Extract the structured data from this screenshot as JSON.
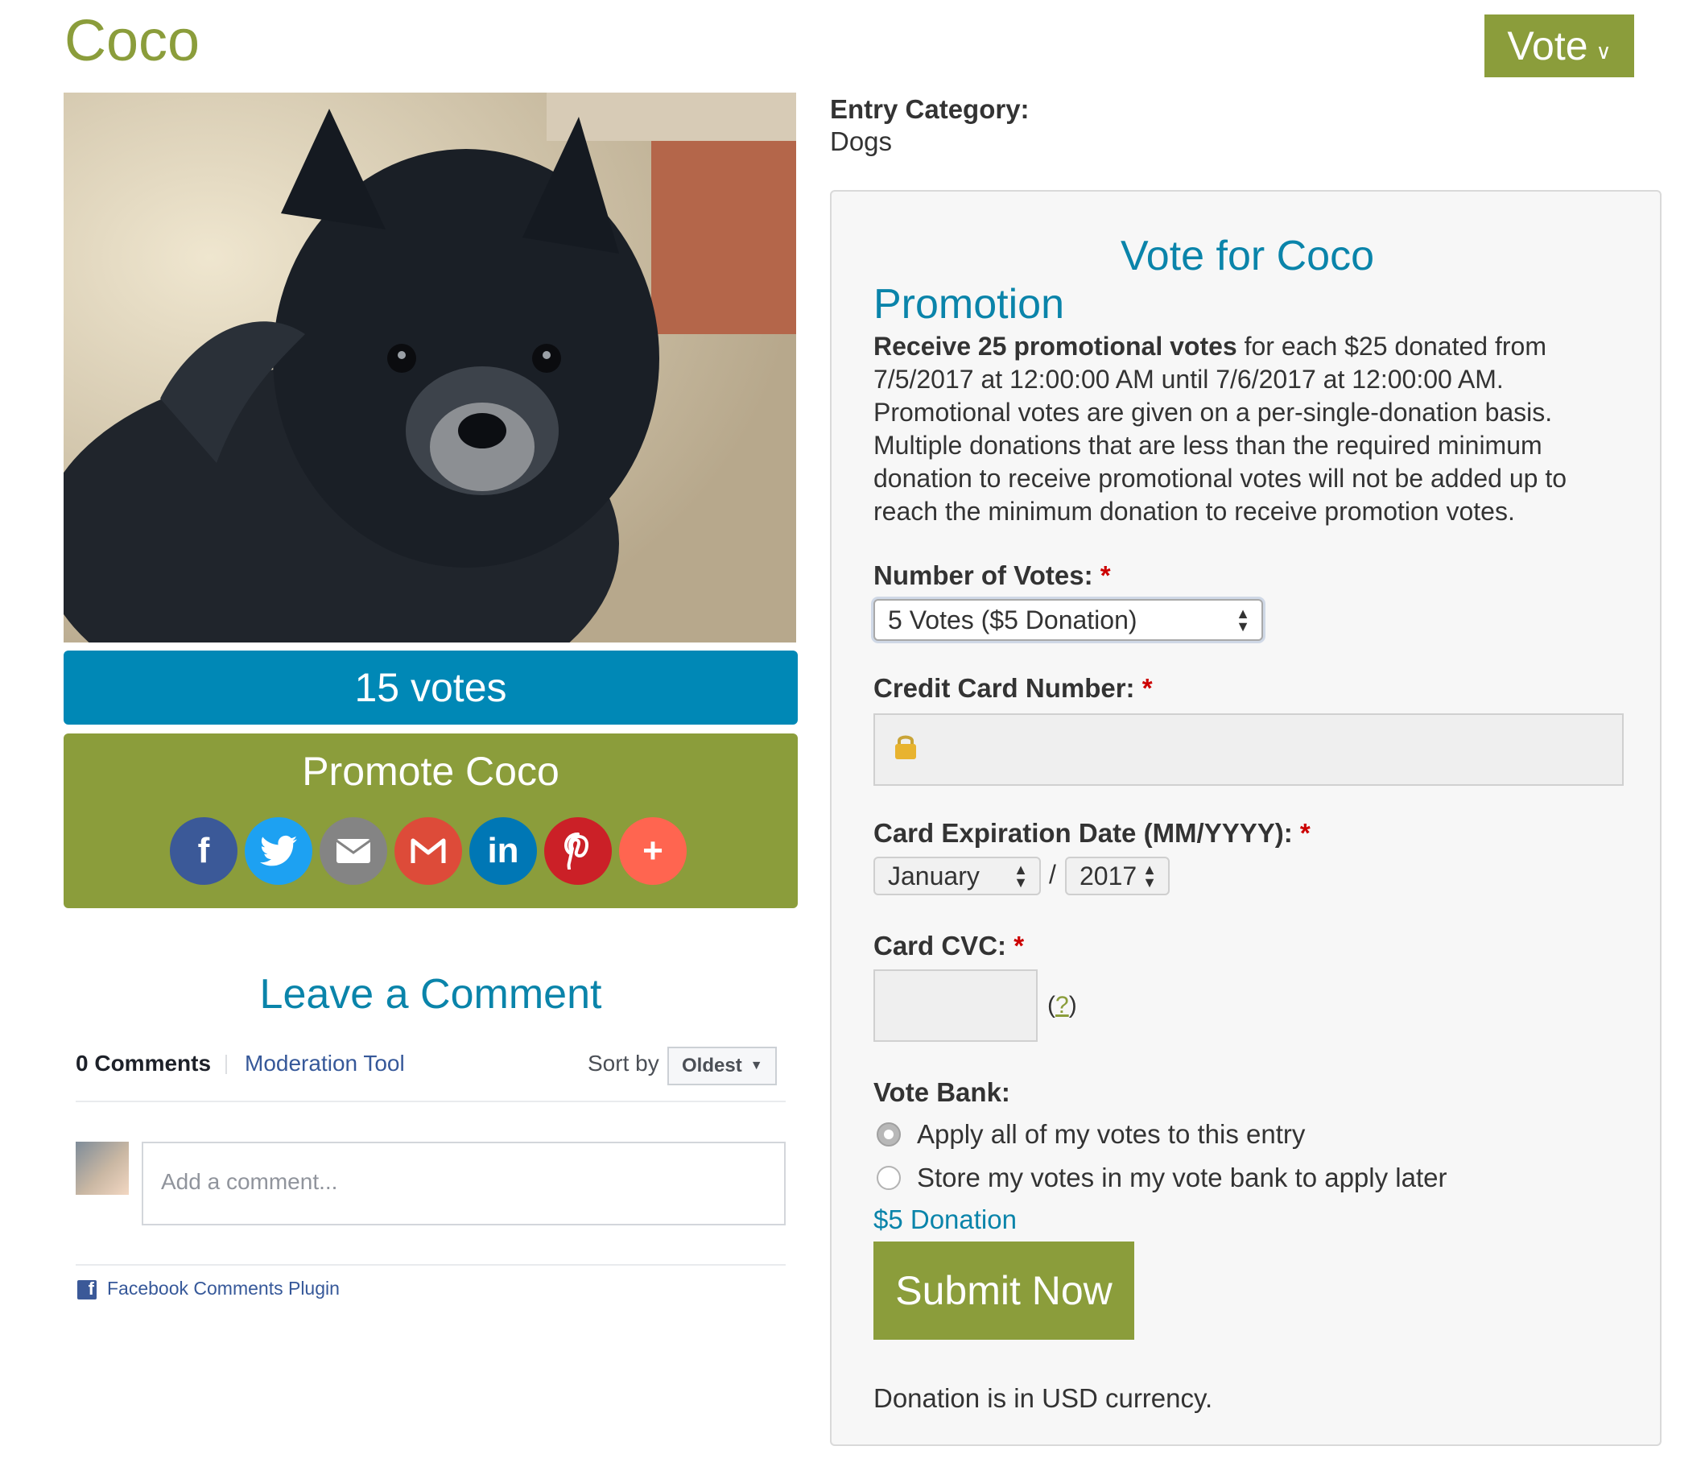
{
  "header": {
    "title": "Coco",
    "vote_button": "Vote"
  },
  "entry": {
    "category_label": "Entry Category:",
    "category_value": "Dogs",
    "votes": "15 votes",
    "promote_title": "Promote Coco",
    "share_icons": [
      "facebook-icon",
      "twitter-icon",
      "email-icon",
      "gmail-icon",
      "linkedin-icon",
      "pinterest-icon",
      "more-icon"
    ],
    "share_colors": [
      "#3b5998",
      "#1da1f2",
      "#848484",
      "#dd4b39",
      "#0077b5",
      "#cb2027",
      "#ff6550"
    ]
  },
  "comments": {
    "heading": "Leave a Comment",
    "count": "0 Comments",
    "moderation": "Moderation Tool",
    "sort_label": "Sort by",
    "sort_value": "Oldest",
    "input_placeholder": "Add a comment...",
    "plugin_label": "Facebook Comments Plugin"
  },
  "vote_form": {
    "title": "Vote for Coco",
    "promo_heading": "Promotion",
    "promo_bold": "Receive 25 promotional votes",
    "promo_rest": " for each $25 donated from 7/5/2017 at 12:00:00 AM until 7/6/2017 at 12:00:00 AM. Promotional votes are given on a per-single-donation basis. Multiple donations that are less than the required minimum donation to receive promotional votes will not be added up to reach the minimum donation to receive promotion votes.",
    "votes_label": "Number of Votes:",
    "votes_value": "5 Votes ($5 Donation)",
    "cc_label": "Credit Card Number:",
    "exp_label": "Card Expiration Date (MM/YYYY):",
    "exp_month": "January",
    "exp_sep": "/",
    "exp_year": "2017",
    "cvc_label": "Card CVC:",
    "cvc_help_open": "(",
    "cvc_help_q": "?",
    "cvc_help_close": ")",
    "vote_bank_label": "Vote Bank:",
    "option_apply": "Apply all of my votes to this entry",
    "option_store": "Store my votes in my vote bank to apply later",
    "donation_amount": "$5 Donation",
    "submit": "Submit Now",
    "currency_note": "Donation is in USD currency.",
    "required_mark": "*"
  }
}
